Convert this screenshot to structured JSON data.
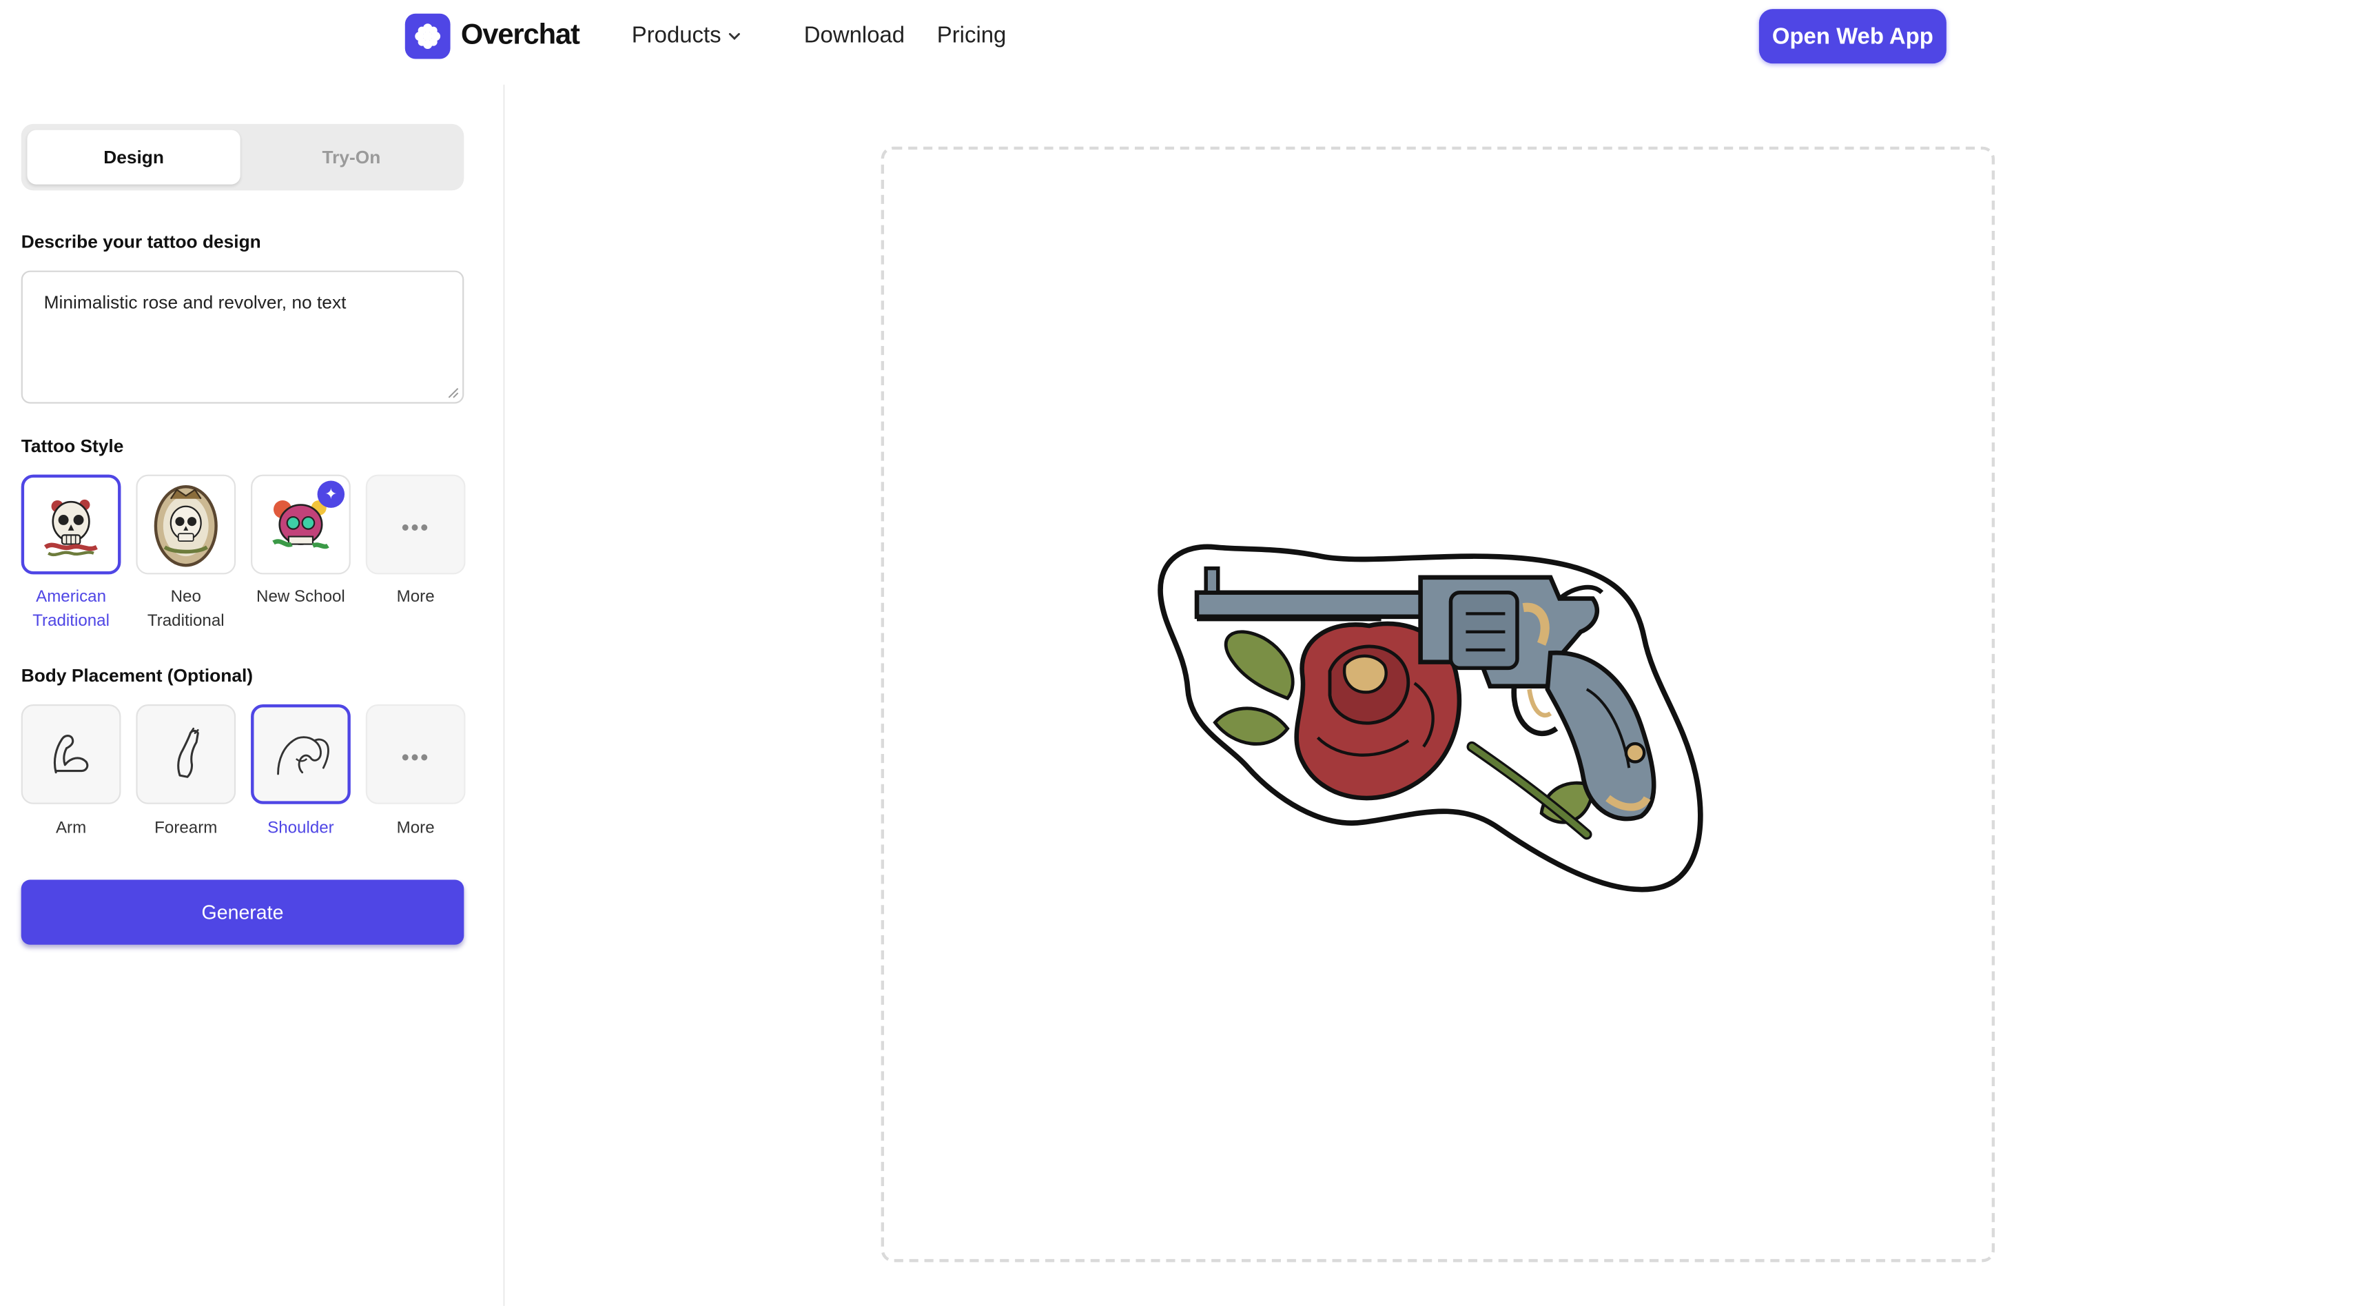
{
  "header": {
    "brand": "Overchat",
    "nav": {
      "products": "Products",
      "download": "Download",
      "pricing": "Pricing"
    },
    "cta": "Open Web App"
  },
  "sidebar": {
    "tabs": {
      "design": "Design",
      "tryon": "Try-On",
      "active": "Design"
    },
    "prompt_label": "Describe your tattoo design",
    "prompt_value": "Minimalistic rose and revolver, no text",
    "style_label": "Tattoo Style",
    "styles": [
      {
        "line1": "American",
        "line2": "Traditional",
        "selected": true
      },
      {
        "line1": "Neo",
        "line2": "Traditional",
        "selected": false
      },
      {
        "line1": "New School",
        "line2": "",
        "selected": false
      },
      {
        "line1": "More",
        "line2": "",
        "selected": false
      }
    ],
    "placement_label": "Body Placement (Optional)",
    "placements": [
      {
        "label": "Arm",
        "selected": false
      },
      {
        "label": "Forearm",
        "selected": false
      },
      {
        "label": "Shoulder",
        "selected": true
      },
      {
        "label": "More",
        "selected": false
      }
    ],
    "generate": "Generate"
  },
  "colors": {
    "accent": "#4f46e5",
    "rose": "#a3393b",
    "gun": "#7b8d9c",
    "leaf": "#7a8f45",
    "tan": "#d6b274"
  },
  "icons": {
    "logo": "asterisk-logo-icon",
    "products": "chevron-down-icon",
    "new_school_badge": "sparkle-icon"
  }
}
